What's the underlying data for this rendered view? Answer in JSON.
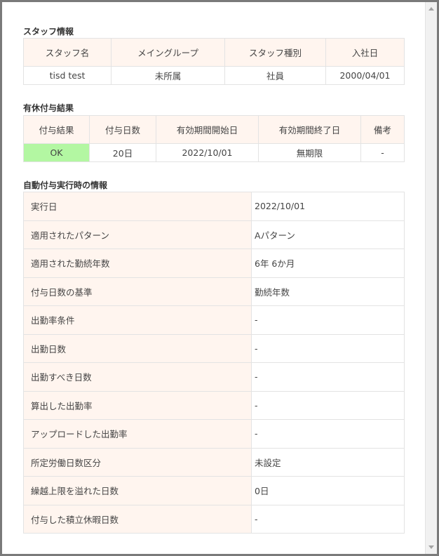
{
  "staff_section": {
    "title": "スタッフ情報",
    "headers": [
      "スタッフ名",
      "メイングループ",
      "スタッフ種別",
      "入社日"
    ],
    "row": [
      "tisd test",
      "未所属",
      "社員",
      "2000/04/01"
    ]
  },
  "grant_section": {
    "title": "有休付与結果",
    "headers": [
      "付与結果",
      "付与日数",
      "有効期間開始日",
      "有効期間終了日",
      "備考"
    ],
    "row": [
      "OK",
      "20日",
      "2022/10/01",
      "無期限",
      "-"
    ],
    "ok_color": "#b3f7a2"
  },
  "auto_section": {
    "title": "自動付与実行時の情報",
    "rows": [
      {
        "label": "実行日",
        "value": "2022/10/01"
      },
      {
        "label": "適用されたパターン",
        "value": "Aパターン"
      },
      {
        "label": "適用された勤続年数",
        "value": "6年 6か月"
      },
      {
        "label": "付与日数の基準",
        "value": "勤続年数"
      },
      {
        "label": "出勤率条件",
        "value": "-"
      },
      {
        "label": "出勤日数",
        "value": "-"
      },
      {
        "label": "出勤すべき日数",
        "value": "-"
      },
      {
        "label": "算出した出勤率",
        "value": "-"
      },
      {
        "label": "アップロードした出勤率",
        "value": "-"
      },
      {
        "label": "所定労働日数区分",
        "value": "未設定"
      },
      {
        "label": "繰越上限を溢れた日数",
        "value": "0日"
      },
      {
        "label": "付与した積立休暇日数",
        "value": "-"
      }
    ]
  },
  "colors": {
    "header_bg": "#fff5ef",
    "border": "#e3e3e3"
  }
}
